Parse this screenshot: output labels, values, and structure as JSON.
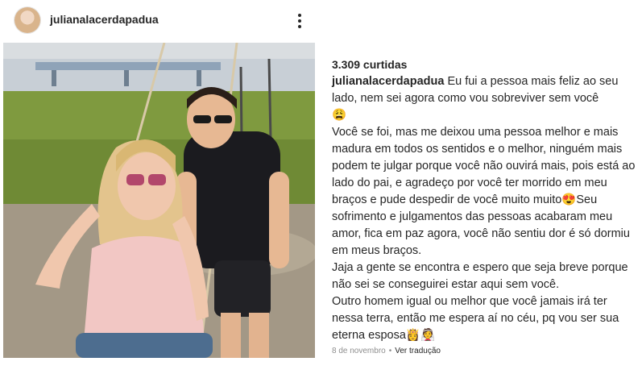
{
  "post": {
    "username": "julianalacerdapadua",
    "likes": "3.309 curtidas",
    "caption_author": "julianalacerdapadua",
    "caption_text": " Eu fui a pessoa mais feliz ao seu lado, nem sei agora como vou sobreviver sem você\n😩\nVocê se foi, mas me deixou uma pessoa melhor e mais madura em todos os sentidos e o melhor, ninguém mais podem te julgar porque você não ouvirá mais, pois está ao lado do pai, e agradeço por você ter morrido em meu braços e pude despedir de você muito muito😍Seu sofrimento e julgamentos das pessoas acabaram meu amor, fica em paz agora, você não sentiu dor é só dormiu em meus braços.\nJaja a gente se encontra e espero que seja breve porque não sei se conseguirei estar aqui sem você.\nOutro homem igual ou melhor que você jamais irá  ter nessa terra, então me espera aí no céu, pq vou ser sua eterna esposa👸👰",
    "date": "8 de novembro",
    "separator": "•",
    "translate_label": "Ver tradução"
  },
  "icons": {
    "more": "more-options-icon",
    "avatar": "avatar"
  },
  "colors": {
    "text": "#262626",
    "secondary": "#8e8e8e",
    "background": "#ffffff"
  }
}
